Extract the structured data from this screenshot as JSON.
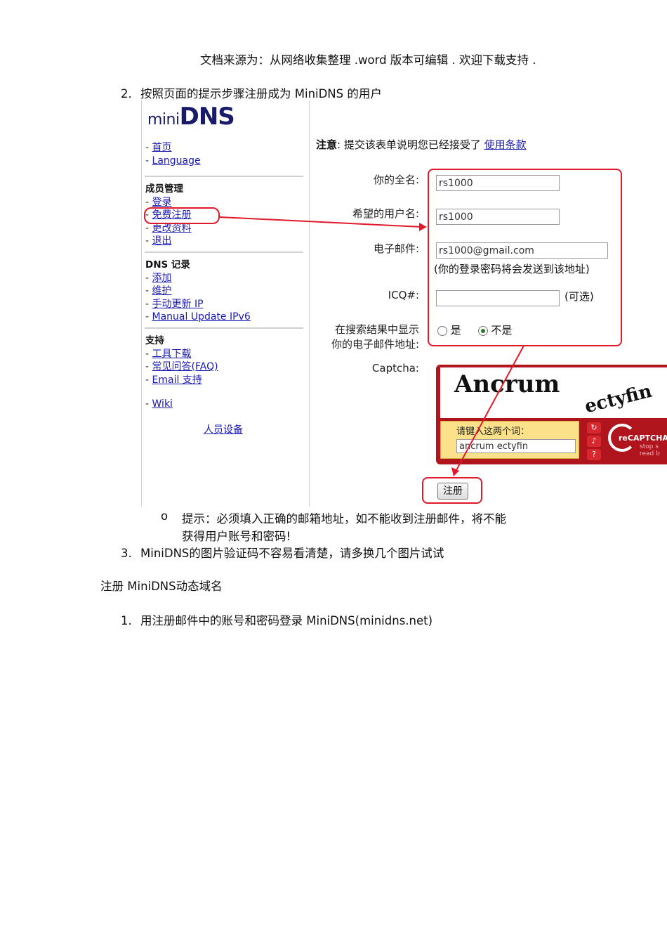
{
  "header": "文档来源为：从网络收集整理 .word 版本可编辑 . 欢迎下载支持 .",
  "step2": {
    "number": "2.",
    "text": "按照页面的提示步骤注册成为 MiniDNS 的用户"
  },
  "shot": {
    "logo_mini": "mini",
    "logo_dns": "DNS",
    "nav": [
      {
        "label": "首页"
      },
      {
        "label": "Language"
      }
    ],
    "member": {
      "heading": "成员管理",
      "items": [
        "登录",
        "免费注册",
        "更改资料",
        "退出"
      ]
    },
    "dns": {
      "heading": "DNS 记录",
      "items": [
        "添加",
        "维护",
        "手动更新 IP",
        "Manual Update IPv6"
      ]
    },
    "support": {
      "heading": "支持",
      "items": [
        "工具下载",
        "常见问答(FAQ)",
        "Email 支持"
      ]
    },
    "wiki": "Wiki",
    "people": "人员设备",
    "notice_prefix": "注意",
    "notice_text": ": 提交该表单说明您已经接受了 ",
    "terms_link": "使用条款",
    "form": {
      "fullname_label": "你的全名:",
      "fullname_value": "rs1000",
      "username_label": "希望的用户名:",
      "username_value": "rs1000",
      "email_label": "电子邮件:",
      "email_value": "rs1000@gmail.com",
      "email_hint": "(你的登录密码将会发送到该地址)",
      "icq_label": "ICQ#:",
      "icq_value": "",
      "icq_optional": "(可选)",
      "show_email_label_1": "在搜索结果中显示",
      "show_email_label_2": "你的电子邮件地址:",
      "radio_yes": "是",
      "radio_no": "不是",
      "captcha_label": "Captcha:",
      "captcha_word1": "Ancrum",
      "captcha_word2": "ectyfin",
      "captcha_prompt": "请键入这两个词：",
      "captcha_input": "ancrum ectyfin",
      "recaptcha_brand": "reCAPTCHA",
      "recaptcha_tag_1": "stop s",
      "recaptcha_tag_2": "read b",
      "submit": "注册"
    }
  },
  "tip": {
    "bullet": "o",
    "line1": "提示：必须填入正确的邮箱地址，如不能收到注册邮件，将不能",
    "line2": "获得用户账号和密码!"
  },
  "step3": {
    "number": "3.",
    "text": "MiniDNS的图片验证码不容易看清楚，请多换几个图片试试"
  },
  "section_title": "注册 MiniDNS动态域名",
  "step1": {
    "number": "1.",
    "text": "用注册邮件中的账号和密码登录 MiniDNS(minidns.net)"
  },
  "colors": {
    "annotation_red": "#e01a2a",
    "link_blue": "#1a1ab4",
    "captcha_red": "#b0141d"
  }
}
